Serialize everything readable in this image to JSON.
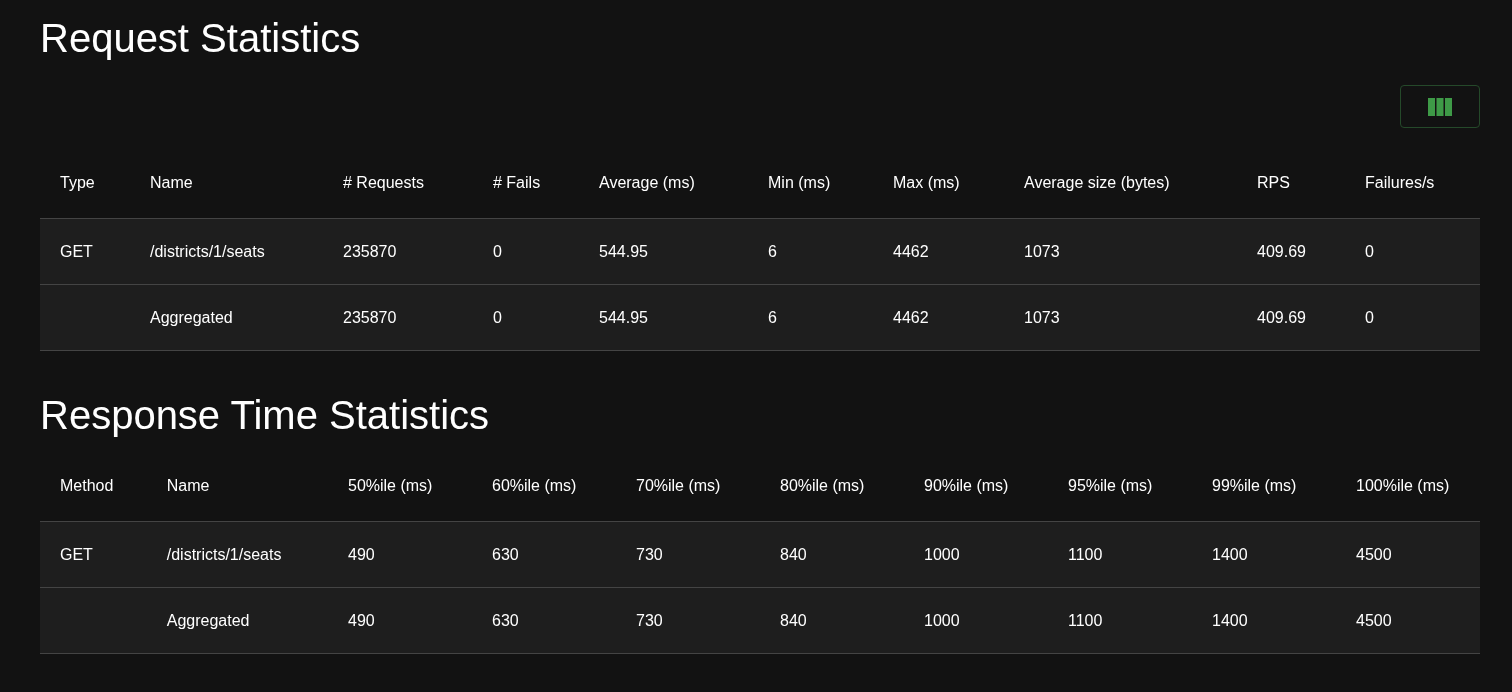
{
  "request_statistics": {
    "title": "Request Statistics",
    "columns": [
      "Type",
      "Name",
      "# Requests",
      "# Fails",
      "Average (ms)",
      "Min (ms)",
      "Max (ms)",
      "Average size (bytes)",
      "RPS",
      "Failures/s"
    ],
    "rows": [
      {
        "type": "GET",
        "name": "/districts/1/seats",
        "values": [
          "235870",
          "0",
          "544.95",
          "6",
          "4462",
          "1073",
          "409.69",
          "0"
        ]
      },
      {
        "name": "Aggregated",
        "values": [
          "235870",
          "0",
          "544.95",
          "6",
          "4462",
          "1073",
          "409.69",
          "0"
        ]
      }
    ]
  },
  "response_time_statistics": {
    "title": "Response Time Statistics",
    "columns": [
      "Method",
      "Name",
      "50%ile (ms)",
      "60%ile (ms)",
      "70%ile (ms)",
      "80%ile (ms)",
      "90%ile (ms)",
      "95%ile (ms)",
      "99%ile (ms)",
      "100%ile (ms)"
    ],
    "rows": [
      {
        "type": "GET",
        "name": "/districts/1/seats",
        "values": [
          "490",
          "630",
          "730",
          "840",
          "1000",
          "1100",
          "1400",
          "4500"
        ]
      },
      {
        "name": "Aggregated",
        "values": [
          "490",
          "630",
          "730",
          "840",
          "1000",
          "1100",
          "1400",
          "4500"
        ]
      }
    ]
  }
}
